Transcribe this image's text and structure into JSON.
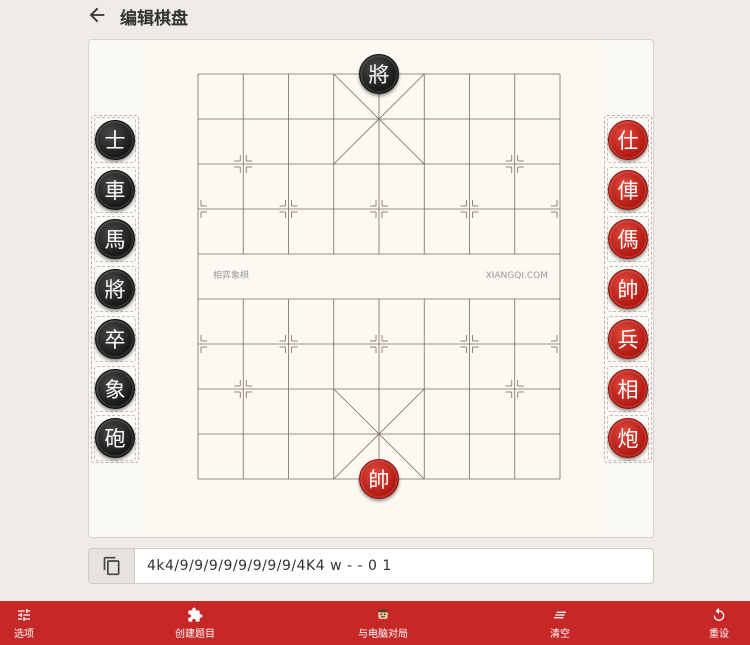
{
  "header": {
    "title": "编辑棋盘"
  },
  "board": {
    "watermark_left": "相弈象棋",
    "watermark_right": "XIANGQI.COM",
    "pieces": [
      {
        "char": "將",
        "color": "black",
        "file": 4,
        "rank": 0
      },
      {
        "char": "帥",
        "color": "red",
        "file": 4,
        "rank": 9
      }
    ]
  },
  "tray_black": [
    "士",
    "車",
    "馬",
    "將",
    "卒",
    "象",
    "砲"
  ],
  "tray_red": [
    "仕",
    "俥",
    "傌",
    "帥",
    "兵",
    "相",
    "炮"
  ],
  "fen": {
    "value": "4k4/9/9/9/9/9/9/9/9/4K4 w - - 0 1"
  },
  "bottom_bar": {
    "options": "选项",
    "create_puzzle": "创建题目",
    "vs_computer": "与电脑对局",
    "clear": "清空",
    "reset": "重设"
  },
  "colors": {
    "red_bar": "#c62828",
    "board_line": "#7a6a5e",
    "red_piece": "#c41e16",
    "black_piece": "#1c1c1c"
  }
}
